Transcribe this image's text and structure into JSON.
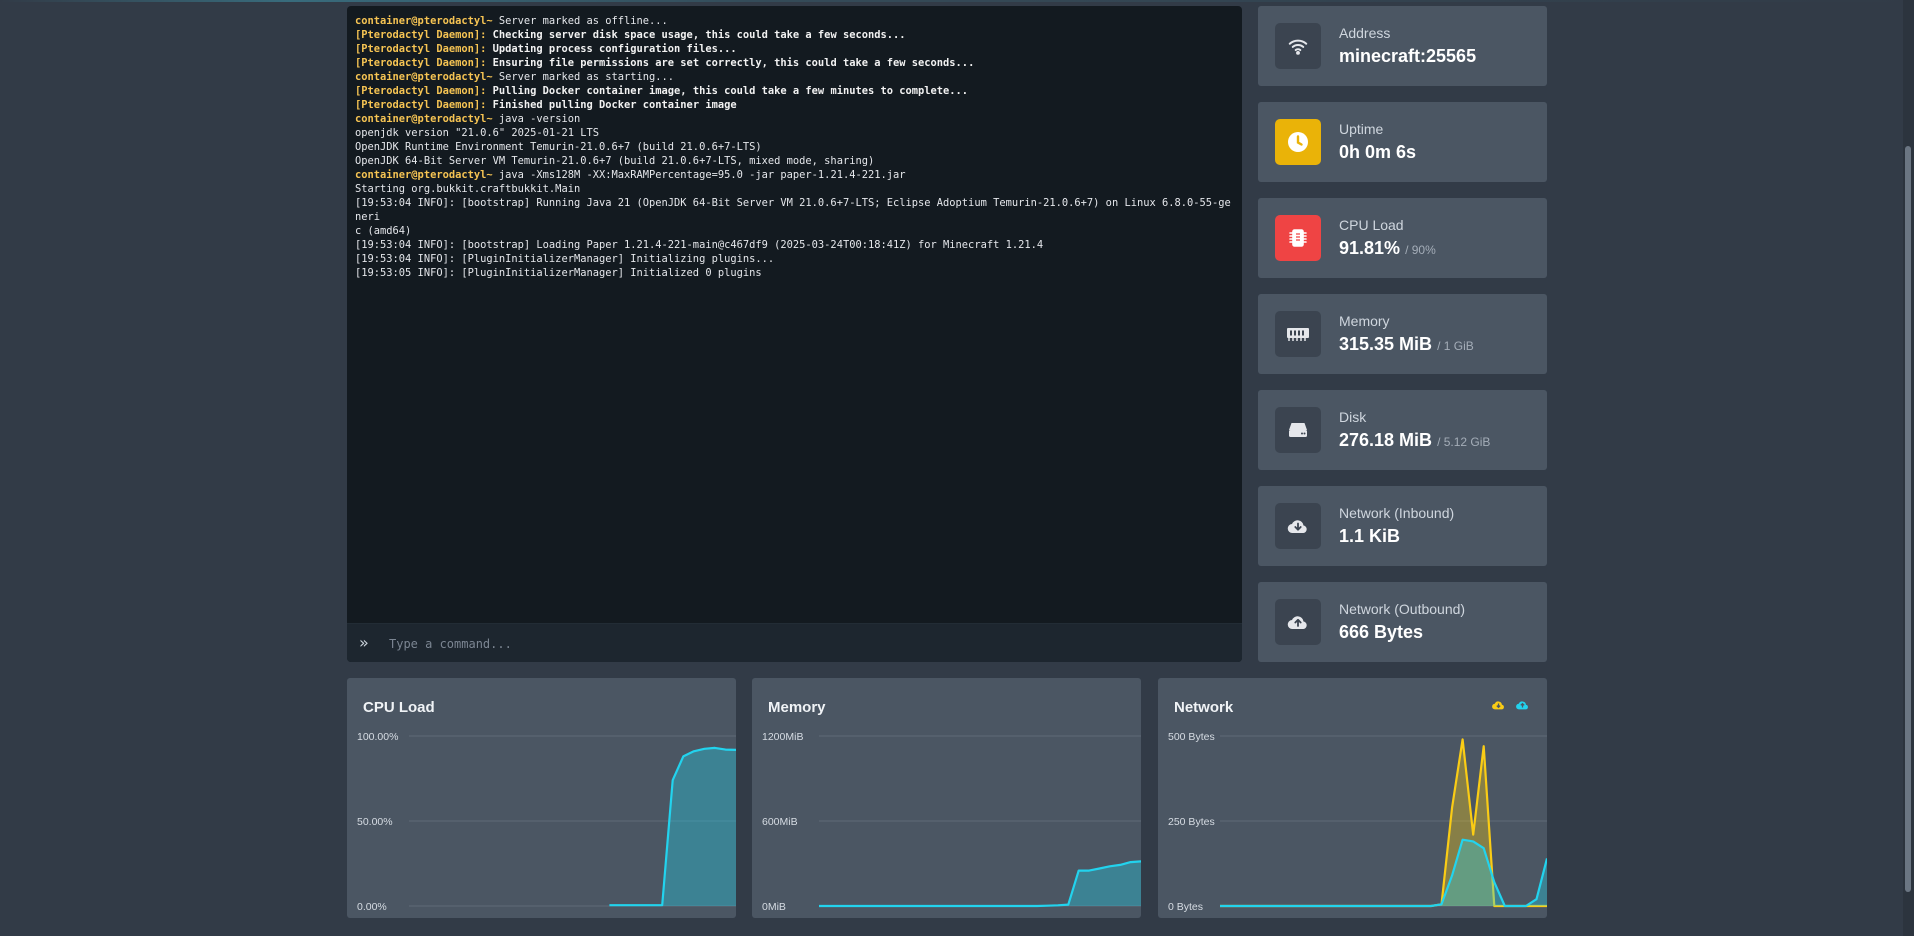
{
  "console": {
    "lines": [
      [
        {
          "t": "container@pterodactyl~ ",
          "c": "pfx"
        },
        {
          "t": "Server marked as offline...",
          "c": ""
        }
      ],
      [
        {
          "t": "[Pterodactyl Daemon]:",
          "c": "pfx2"
        },
        {
          "t": " Checking server disk space usage, this could take a few seconds...",
          "c": "bold"
        }
      ],
      [
        {
          "t": "[Pterodactyl Daemon]:",
          "c": "pfx2"
        },
        {
          "t": " Updating process configuration files...",
          "c": "bold"
        }
      ],
      [
        {
          "t": "[Pterodactyl Daemon]:",
          "c": "pfx2"
        },
        {
          "t": " Ensuring file permissions are set correctly, this could take a few seconds...",
          "c": "bold"
        }
      ],
      [
        {
          "t": "container@pterodactyl~ ",
          "c": "pfx"
        },
        {
          "t": "Server marked as starting...",
          "c": ""
        }
      ],
      [
        {
          "t": "[Pterodactyl Daemon]:",
          "c": "pfx2"
        },
        {
          "t": " Pulling Docker container image, this could take a few minutes to complete...",
          "c": "bold"
        }
      ],
      [
        {
          "t": "[Pterodactyl Daemon]:",
          "c": "pfx2"
        },
        {
          "t": " Finished pulling Docker container image",
          "c": "bold"
        }
      ],
      [
        {
          "t": "container@pterodactyl~ ",
          "c": "pfx"
        },
        {
          "t": "java -version",
          "c": ""
        }
      ],
      [
        {
          "t": "openjdk version \"21.0.6\" 2025-01-21 LTS",
          "c": ""
        }
      ],
      [
        {
          "t": "OpenJDK Runtime Environment Temurin-21.0.6+7 (build 21.0.6+7-LTS)",
          "c": ""
        }
      ],
      [
        {
          "t": "OpenJDK 64-Bit Server VM Temurin-21.0.6+7 (build 21.0.6+7-LTS, mixed mode, sharing)",
          "c": ""
        }
      ],
      [
        {
          "t": "container@pterodactyl~ ",
          "c": "pfx"
        },
        {
          "t": "java -Xms128M -XX:MaxRAMPercentage=95.0 -jar paper-1.21.4-221.jar",
          "c": ""
        }
      ],
      [
        {
          "t": "Starting org.bukkit.craftbukkit.Main",
          "c": ""
        }
      ],
      [
        {
          "t": "[19:53:04 INFO]: [bootstrap] Running Java 21 (OpenJDK 64-Bit Server VM 21.0.6+7-LTS; Eclipse Adoptium Temurin-21.0.6+7) on Linux 6.8.0-55-generi",
          "c": ""
        }
      ],
      [
        {
          "t": "c (amd64)",
          "c": ""
        }
      ],
      [
        {
          "t": "[19:53:04 INFO]: [bootstrap] Loading Paper 1.21.4-221-main@c467df9 (2025-03-24T00:18:41Z) for Minecraft 1.21.4",
          "c": ""
        }
      ],
      [
        {
          "t": "[19:53:04 INFO]: [PluginInitializerManager] Initializing plugins...",
          "c": ""
        }
      ],
      [
        {
          "t": "[19:53:05 INFO]: [PluginInitializerManager] Initialized 0 plugins",
          "c": ""
        }
      ]
    ],
    "command_placeholder": "Type a command...",
    "prompt_glyph": "»"
  },
  "stats": {
    "address": {
      "label": "Address",
      "value": "minecraft:25565",
      "icon": "wifi-icon"
    },
    "uptime": {
      "label": "Uptime",
      "value": "0h 0m 6s",
      "icon": "clock-icon",
      "color": "#eab308"
    },
    "cpu": {
      "label": "CPU Load",
      "value": "91.81%",
      "limit": "/ 90%",
      "icon": "cpu-chip-icon",
      "color": "#ef4444"
    },
    "memory": {
      "label": "Memory",
      "value": "315.35 MiB",
      "limit": "/ 1 GiB",
      "icon": "memory-stick-icon"
    },
    "disk": {
      "label": "Disk",
      "value": "276.18 MiB",
      "limit": "/ 5.12 GiB",
      "icon": "hard-drive-icon"
    },
    "net_in": {
      "label": "Network (Inbound)",
      "value": "1.1 KiB",
      "icon": "cloud-download-icon"
    },
    "net_out": {
      "label": "Network (Outbound)",
      "value": "666 Bytes",
      "icon": "cloud-upload-icon"
    }
  },
  "charts": {
    "cpu": {
      "title": "CPU Load"
    },
    "memory": {
      "title": "Memory"
    },
    "network": {
      "title": "Network",
      "legend_icons": [
        "cloud-download-icon",
        "cloud-upload-icon"
      ]
    }
  },
  "chart_data": [
    {
      "type": "area",
      "title": "CPU Load",
      "ytick_labels": [
        "100.00%",
        "50.00%",
        "0.00%"
      ],
      "ylim": [
        0,
        100
      ],
      "color": "#22d3ee",
      "series": [
        {
          "values": [
            null,
            null,
            null,
            null,
            null,
            null,
            null,
            null,
            null,
            null,
            null,
            null,
            null,
            null,
            null,
            null,
            null,
            null,
            null,
            0.5,
            0.5,
            0.5,
            0.5,
            0.5,
            0.5,
            74,
            88,
            91,
            92.5,
            93,
            92,
            91.8
          ]
        }
      ]
    },
    {
      "type": "area",
      "title": "Memory",
      "ytick_labels": [
        "1200MiB",
        "600MiB",
        "0MiB"
      ],
      "ylim": [
        0,
        1200
      ],
      "color": "#22d3ee",
      "series": [
        {
          "values": [
            0,
            0,
            0,
            0,
            0,
            0,
            0,
            0,
            0,
            0,
            0,
            0,
            0,
            0,
            0,
            0,
            0,
            0,
            0,
            0,
            0,
            0,
            2,
            5,
            10,
            250,
            250,
            265,
            280,
            290,
            310,
            315
          ]
        }
      ]
    },
    {
      "type": "area",
      "title": "Network",
      "ytick_labels": [
        "500 Bytes",
        "250 Bytes",
        "0 Bytes"
      ],
      "ylim": [
        0,
        500
      ],
      "series": [
        {
          "color": "#facc15",
          "values": [
            0,
            0,
            0,
            0,
            0,
            0,
            0,
            0,
            0,
            0,
            0,
            0,
            0,
            0,
            0,
            0,
            0,
            0,
            0,
            0,
            0,
            5,
            290,
            490,
            210,
            470,
            0,
            0,
            0,
            0,
            0,
            0
          ]
        },
        {
          "color": "#22d3ee",
          "values": [
            0,
            0,
            0,
            0,
            0,
            0,
            0,
            0,
            0,
            0,
            0,
            0,
            0,
            0,
            0,
            0,
            0,
            0,
            0,
            0,
            0,
            5,
            90,
            195,
            190,
            170,
            70,
            0,
            0,
            0,
            20,
            140
          ]
        }
      ]
    }
  ]
}
